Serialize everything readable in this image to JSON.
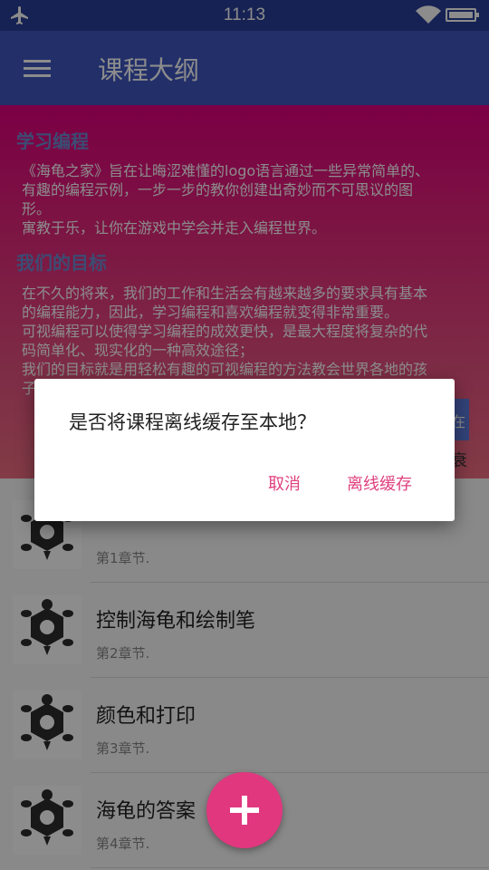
{
  "status_bar": {
    "time": "11:13",
    "icons": [
      "airplane-icon",
      "wifi-icon",
      "battery-icon"
    ]
  },
  "app_bar": {
    "title": "课程大纲",
    "menu_icon": "hamburger-menu-icon"
  },
  "intro": {
    "heading1": "学习编程",
    "para1_line1": "《海龟之家》旨在让晦涩难懂的logo语言通过一些异常简单的、",
    "para1_line2": "有趣的编程示例，一步一步的教你创建出奇妙而不可思议的图",
    "para1_line3": "形。",
    "para1_line4": "寓教于乐，让你在游戏中学会并走入编程世界。",
    "heading2": "我们的目标",
    "para2_line1": "在不久的将来，我们的工作和生活会有越来越多的要求具有基本",
    "para2_line2": "的编程能力，因此，学习编程和喜欢编程就变得非常重要。",
    "para2_line3": " 可视编程可以使得学习编程的成效更快，是最大程度将复杂的代",
    "para2_line4": "码简单化、现实化的一种高效途径；",
    "para2_line5": " 我们的目标就是用轻松有趣的可视编程的方法教会世界各地的孩",
    "para2_line6": "子",
    "partial_button": "在",
    "partial_text": "衰"
  },
  "chapters": [
    {
      "title": "",
      "subtitle": "第1章节."
    },
    {
      "title": "控制海龟和绘制笔",
      "subtitle": "第2章节."
    },
    {
      "title": "颜色和打印",
      "subtitle": "第3章节."
    },
    {
      "title": "海龟的答案",
      "subtitle": "第4章节."
    }
  ],
  "dialog": {
    "message": "是否将课程离线缓存至本地？",
    "cancel_label": "取消",
    "confirm_label": "离线缓存"
  },
  "fab": {
    "icon": "plus-icon"
  },
  "colors": {
    "primary": "#3f56bf",
    "primary_dark": "#283f97",
    "accent": "#e0407f"
  }
}
